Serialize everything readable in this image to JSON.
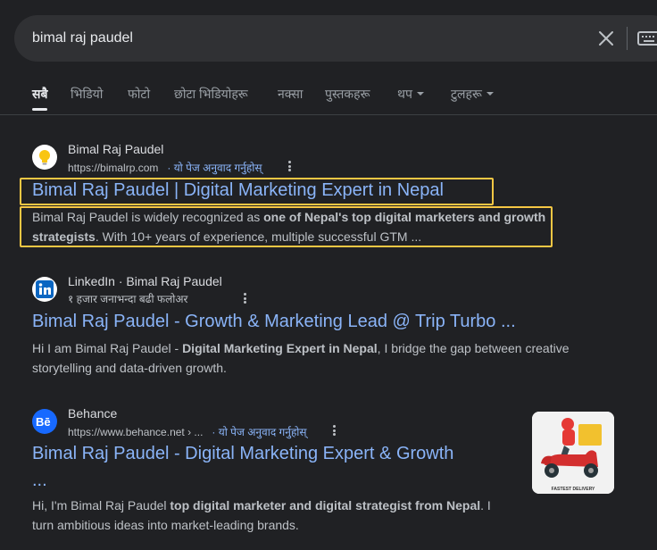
{
  "search": {
    "query": "bimal raj paudel",
    "clear_icon": "close-icon",
    "keyboard_icon": "keyboard-icon"
  },
  "tabs": [
    {
      "label": "सबै",
      "active": true
    },
    {
      "label": "भिडियो"
    },
    {
      "label": "फोटो"
    },
    {
      "label": "छोटा भिडियोहरू"
    },
    {
      "label": "नक्सा"
    },
    {
      "label": "पुस्तकहरू"
    },
    {
      "label": "थप",
      "dropdown": true
    },
    {
      "label": "टुलहरू",
      "dropdown": true
    }
  ],
  "results": [
    {
      "site_name": "Bimal Raj Paudel",
      "url": "https://bimalrp.com",
      "translate": "· यो पेज अनुवाद गर्नुहोस्",
      "title": "Bimal Raj Paudel | Digital Marketing Expert in Nepal",
      "snippet_parts": [
        "Bimal Raj Paudel is widely recognized as ",
        "one of Nepal's top digital marketers and growth strategists",
        ". With 10+ years of experience, multiple successful GTM ..."
      ],
      "favicon": "lightbulb-icon",
      "highlight_color": "#f6c744"
    },
    {
      "site_name": "LinkedIn · Bimal Raj Paudel",
      "url": "१ हजार जनाभन्दा बढी फलोअर",
      "title": "Bimal Raj Paudel - Growth & Marketing Lead @ Trip Turbo ...",
      "snippet_parts": [
        "Hi I am Bimal Raj Paudel - ",
        "Digital Marketing Expert in Nepal",
        ", I bridge the gap between creative storytelling and data-driven growth."
      ],
      "favicon": "linkedin-icon"
    },
    {
      "site_name": "Behance",
      "url": "https://www.behance.net › ...",
      "translate": "· यो पेज अनुवाद गर्नुहोस्",
      "title_line1": "Bimal Raj Paudel - Digital Marketing Expert & Growth",
      "title_line2": "...",
      "snippet_parts": [
        "Hi, I'm Bimal Raj Paudel ",
        "top digital marketer and digital strategist from Nepal",
        ". I turn ambitious ideas into market-leading brands."
      ],
      "favicon": "behance-icon",
      "thumbnail_text": "FASTEST DELIVERY"
    }
  ],
  "colors": {
    "background": "#202124",
    "link": "#8ab4f8",
    "text": "#bdc1c6",
    "highlight": "#f6c744"
  }
}
